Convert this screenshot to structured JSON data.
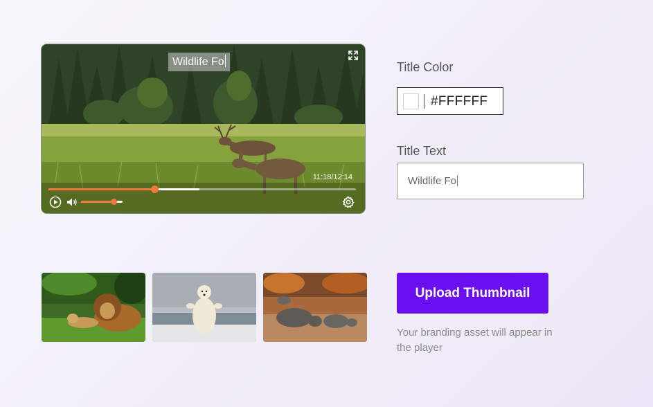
{
  "player": {
    "title_overlay": "Wildlife Fo",
    "time_display": "11:18/12:14",
    "progress": 0.345,
    "buffered": 0.49,
    "volume": 0.78
  },
  "form": {
    "title_color_label": "Title Color",
    "title_color_value": "#FFFFFF",
    "title_text_label": "Title Text",
    "title_text_value": "Wildlife Fo"
  },
  "thumbnails": [
    {
      "name": "lions"
    },
    {
      "name": "polar-bear"
    },
    {
      "name": "rhinos"
    }
  ],
  "upload": {
    "button_label": "Upload Thumbnail",
    "helper_text": "Your branding asset will appear in the player"
  },
  "colors": {
    "accent_orange": "#EE7B3B",
    "primary_purple": "#6A0FF0"
  },
  "icons": [
    "fullscreen-icon",
    "play-icon",
    "volume-icon",
    "settings-icon"
  ]
}
